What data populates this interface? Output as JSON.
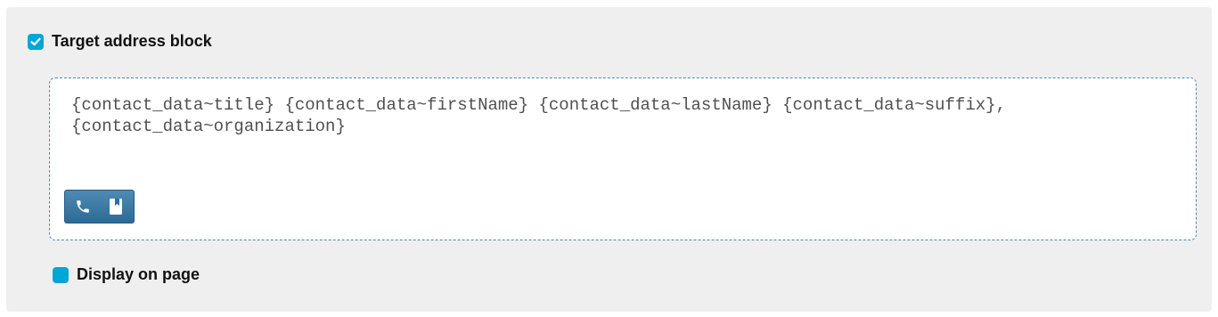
{
  "target_block": {
    "label": "Target address block",
    "checked": true,
    "accent_color": "#00a6d6"
  },
  "editor": {
    "content": "{contact_data~title} {contact_data~firstName} {contact_data~lastName} {contact_data~suffix},\n{contact_data~organization}",
    "toolbar": {
      "buttons": [
        {
          "icon": "phone-icon"
        },
        {
          "icon": "address-book-icon"
        }
      ],
      "color": "#2f6f9a"
    }
  },
  "display_option": {
    "label": "Display on page",
    "checked": false
  }
}
